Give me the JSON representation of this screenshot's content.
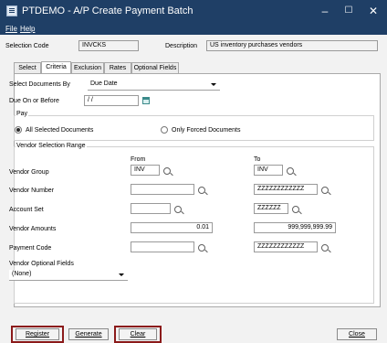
{
  "window": {
    "title": "PTDEMO - A/P Create Payment Batch",
    "minimize": "–",
    "maximize": "☐",
    "close": "✕"
  },
  "menu": {
    "file": "File",
    "help": "Help"
  },
  "header": {
    "selection_code_label": "Selection Code",
    "selection_code_value": "INVCKS",
    "description_label": "Description",
    "description_value": "US inventory purchases vendors"
  },
  "tabs": [
    "Select",
    "Criteria",
    "Exclusion",
    "Rates",
    "Optional Fields"
  ],
  "active_tab": "Criteria",
  "criteria": {
    "select_by_label": "Select Documents By",
    "select_by_value": "Due Date",
    "due_label": "Due On or Before",
    "due_value": " / /"
  },
  "pay": {
    "title": "Pay",
    "all_label": "All Selected Documents",
    "forced_label": "Only Forced Documents",
    "selected": "all"
  },
  "vendor_range": {
    "title": "Vendor Selection Range",
    "from_label": "From",
    "to_label": "To",
    "rows": [
      {
        "label": "Vendor Group",
        "from": "INV",
        "to": "INV"
      },
      {
        "label": "Vendor Number",
        "from": "",
        "to": "ZZZZZZZZZZZZ"
      },
      {
        "label": "Account Set",
        "from": "",
        "to": "ZZZZZZ"
      },
      {
        "label": "Vendor Amounts",
        "from": "0.01",
        "to": "999,999,999.99"
      },
      {
        "label": "Payment Code",
        "from": "",
        "to": "ZZZZZZZZZZZZ"
      }
    ],
    "optional_fields_label": "Vendor Optional Fields",
    "optional_fields_value": "(None)"
  },
  "buttons": {
    "register": "Register",
    "generate": "Generate",
    "clear": "Clear",
    "close": "Close"
  }
}
